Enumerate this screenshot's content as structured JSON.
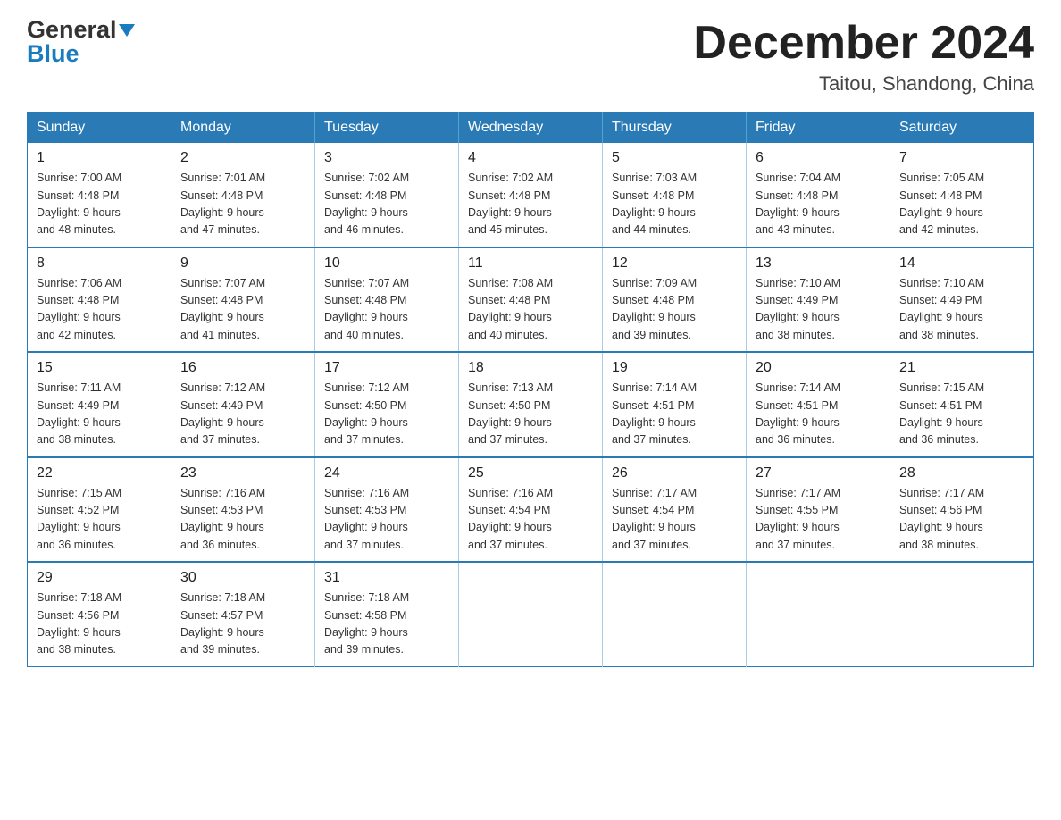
{
  "header": {
    "logo_general": "General",
    "logo_blue": "Blue",
    "month_title": "December 2024",
    "location": "Taitou, Shandong, China"
  },
  "weekdays": [
    "Sunday",
    "Monday",
    "Tuesday",
    "Wednesday",
    "Thursday",
    "Friday",
    "Saturday"
  ],
  "weeks": [
    [
      {
        "day": "1",
        "sunrise": "7:00 AM",
        "sunset": "4:48 PM",
        "daylight": "9 hours and 48 minutes."
      },
      {
        "day": "2",
        "sunrise": "7:01 AM",
        "sunset": "4:48 PM",
        "daylight": "9 hours and 47 minutes."
      },
      {
        "day": "3",
        "sunrise": "7:02 AM",
        "sunset": "4:48 PM",
        "daylight": "9 hours and 46 minutes."
      },
      {
        "day": "4",
        "sunrise": "7:02 AM",
        "sunset": "4:48 PM",
        "daylight": "9 hours and 45 minutes."
      },
      {
        "day": "5",
        "sunrise": "7:03 AM",
        "sunset": "4:48 PM",
        "daylight": "9 hours and 44 minutes."
      },
      {
        "day": "6",
        "sunrise": "7:04 AM",
        "sunset": "4:48 PM",
        "daylight": "9 hours and 43 minutes."
      },
      {
        "day": "7",
        "sunrise": "7:05 AM",
        "sunset": "4:48 PM",
        "daylight": "9 hours and 42 minutes."
      }
    ],
    [
      {
        "day": "8",
        "sunrise": "7:06 AM",
        "sunset": "4:48 PM",
        "daylight": "9 hours and 42 minutes."
      },
      {
        "day": "9",
        "sunrise": "7:07 AM",
        "sunset": "4:48 PM",
        "daylight": "9 hours and 41 minutes."
      },
      {
        "day": "10",
        "sunrise": "7:07 AM",
        "sunset": "4:48 PM",
        "daylight": "9 hours and 40 minutes."
      },
      {
        "day": "11",
        "sunrise": "7:08 AM",
        "sunset": "4:48 PM",
        "daylight": "9 hours and 40 minutes."
      },
      {
        "day": "12",
        "sunrise": "7:09 AM",
        "sunset": "4:48 PM",
        "daylight": "9 hours and 39 minutes."
      },
      {
        "day": "13",
        "sunrise": "7:10 AM",
        "sunset": "4:49 PM",
        "daylight": "9 hours and 38 minutes."
      },
      {
        "day": "14",
        "sunrise": "7:10 AM",
        "sunset": "4:49 PM",
        "daylight": "9 hours and 38 minutes."
      }
    ],
    [
      {
        "day": "15",
        "sunrise": "7:11 AM",
        "sunset": "4:49 PM",
        "daylight": "9 hours and 38 minutes."
      },
      {
        "day": "16",
        "sunrise": "7:12 AM",
        "sunset": "4:49 PM",
        "daylight": "9 hours and 37 minutes."
      },
      {
        "day": "17",
        "sunrise": "7:12 AM",
        "sunset": "4:50 PM",
        "daylight": "9 hours and 37 minutes."
      },
      {
        "day": "18",
        "sunrise": "7:13 AM",
        "sunset": "4:50 PM",
        "daylight": "9 hours and 37 minutes."
      },
      {
        "day": "19",
        "sunrise": "7:14 AM",
        "sunset": "4:51 PM",
        "daylight": "9 hours and 37 minutes."
      },
      {
        "day": "20",
        "sunrise": "7:14 AM",
        "sunset": "4:51 PM",
        "daylight": "9 hours and 36 minutes."
      },
      {
        "day": "21",
        "sunrise": "7:15 AM",
        "sunset": "4:51 PM",
        "daylight": "9 hours and 36 minutes."
      }
    ],
    [
      {
        "day": "22",
        "sunrise": "7:15 AM",
        "sunset": "4:52 PM",
        "daylight": "9 hours and 36 minutes."
      },
      {
        "day": "23",
        "sunrise": "7:16 AM",
        "sunset": "4:53 PM",
        "daylight": "9 hours and 36 minutes."
      },
      {
        "day": "24",
        "sunrise": "7:16 AM",
        "sunset": "4:53 PM",
        "daylight": "9 hours and 37 minutes."
      },
      {
        "day": "25",
        "sunrise": "7:16 AM",
        "sunset": "4:54 PM",
        "daylight": "9 hours and 37 minutes."
      },
      {
        "day": "26",
        "sunrise": "7:17 AM",
        "sunset": "4:54 PM",
        "daylight": "9 hours and 37 minutes."
      },
      {
        "day": "27",
        "sunrise": "7:17 AM",
        "sunset": "4:55 PM",
        "daylight": "9 hours and 37 minutes."
      },
      {
        "day": "28",
        "sunrise": "7:17 AM",
        "sunset": "4:56 PM",
        "daylight": "9 hours and 38 minutes."
      }
    ],
    [
      {
        "day": "29",
        "sunrise": "7:18 AM",
        "sunset": "4:56 PM",
        "daylight": "9 hours and 38 minutes."
      },
      {
        "day": "30",
        "sunrise": "7:18 AM",
        "sunset": "4:57 PM",
        "daylight": "9 hours and 39 minutes."
      },
      {
        "day": "31",
        "sunrise": "7:18 AM",
        "sunset": "4:58 PM",
        "daylight": "9 hours and 39 minutes."
      },
      null,
      null,
      null,
      null
    ]
  ],
  "labels": {
    "sunrise": "Sunrise:",
    "sunset": "Sunset:",
    "daylight": "Daylight:"
  }
}
